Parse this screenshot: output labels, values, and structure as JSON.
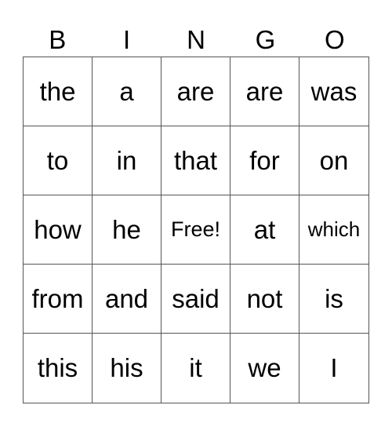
{
  "header": [
    "B",
    "I",
    "N",
    "G",
    "O"
  ],
  "rows": [
    [
      "the",
      "a",
      "are",
      "are",
      "was"
    ],
    [
      "to",
      "in",
      "that",
      "for",
      "on"
    ],
    [
      "how",
      "he",
      "Free!",
      "at",
      "which"
    ],
    [
      "from",
      "and",
      "said",
      "not",
      "is"
    ],
    [
      "this",
      "his",
      "it",
      "we",
      "I"
    ]
  ]
}
